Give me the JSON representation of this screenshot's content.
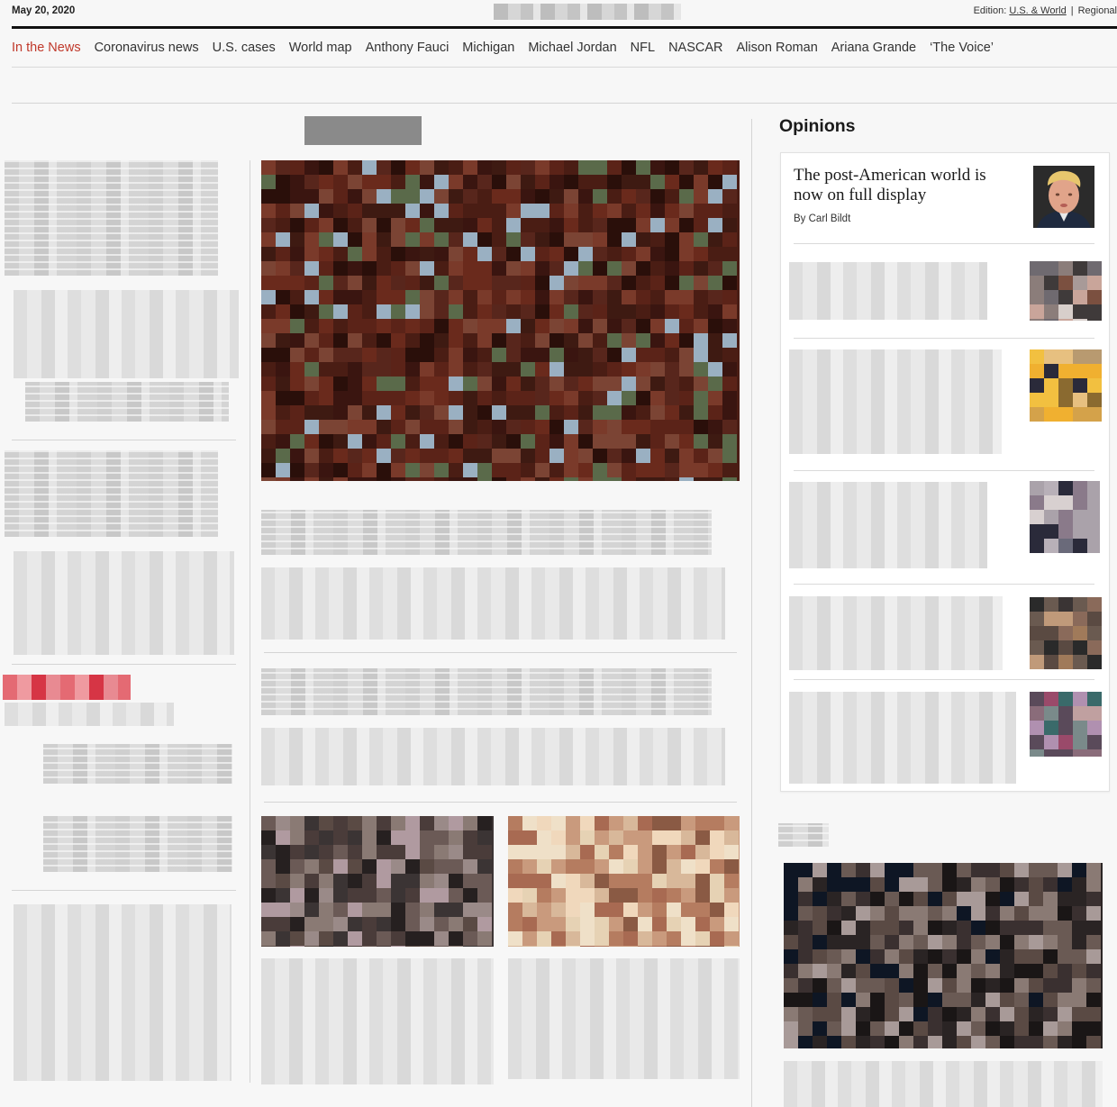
{
  "header": {
    "date": "May 20, 2020",
    "edition_label": "Edition:",
    "edition_selected": "U.S. & World",
    "edition_separator": "|",
    "edition_other": "Regional"
  },
  "nav": {
    "items": [
      {
        "label": "In the News",
        "active": true
      },
      {
        "label": "Coronavirus news"
      },
      {
        "label": "U.S. cases"
      },
      {
        "label": "World map"
      },
      {
        "label": "Anthony Fauci"
      },
      {
        "label": "Michigan"
      },
      {
        "label": "Michael Jordan"
      },
      {
        "label": "NFL"
      },
      {
        "label": "NASCAR"
      },
      {
        "label": "Alison Roman"
      },
      {
        "label": "Ariana Grande"
      },
      {
        "label": "‘The Voice’"
      }
    ]
  },
  "opinions": {
    "title": "Opinions",
    "featured": {
      "headline": "The post-American world is now on full display",
      "byline": "By Carl Bildt"
    }
  },
  "colors": {
    "accent": "#c0392b",
    "text": "#111111"
  },
  "icons": {
    "op_featured_photo": "person-photo"
  }
}
